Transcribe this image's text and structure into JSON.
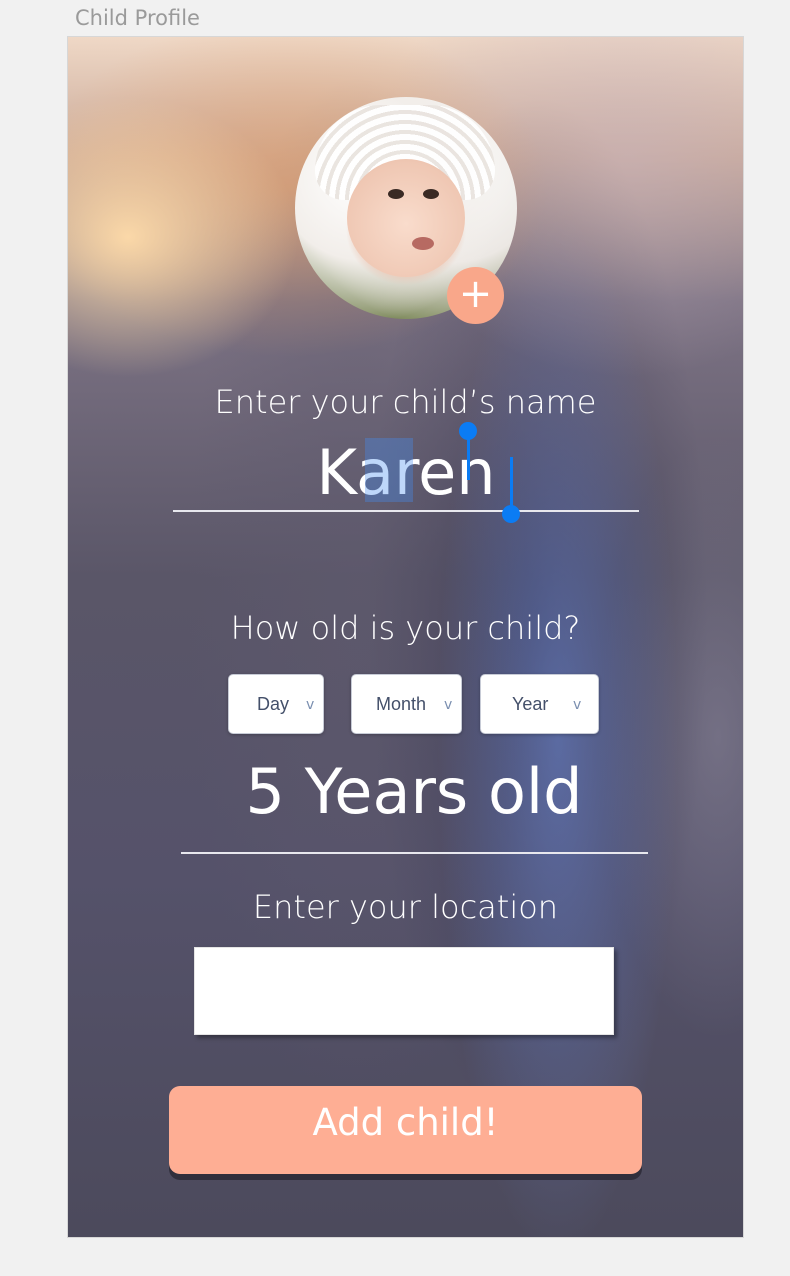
{
  "frame": {
    "title": "Child Profile"
  },
  "avatar": {
    "add_icon": "plus-icon",
    "add_glyph": "+"
  },
  "name_section": {
    "label": "Enter your child’s name",
    "value": "Karen"
  },
  "age_section": {
    "label": "How old is your child?",
    "dropdowns": [
      {
        "label": "Day",
        "arrow": "chevron-down-icon"
      },
      {
        "label": "Month",
        "arrow": "chevron-down-icon"
      },
      {
        "label": "Year",
        "arrow": "chevron-down-icon"
      }
    ],
    "age_text": "5 Years old"
  },
  "location_section": {
    "label": "Enter your location",
    "value": ""
  },
  "actions": {
    "add_label": "Add child!"
  },
  "colors": {
    "accent": "#feae94",
    "avatar_add": "#f9a78a",
    "selection": "#0b7cf4",
    "text": "#ffffff"
  }
}
